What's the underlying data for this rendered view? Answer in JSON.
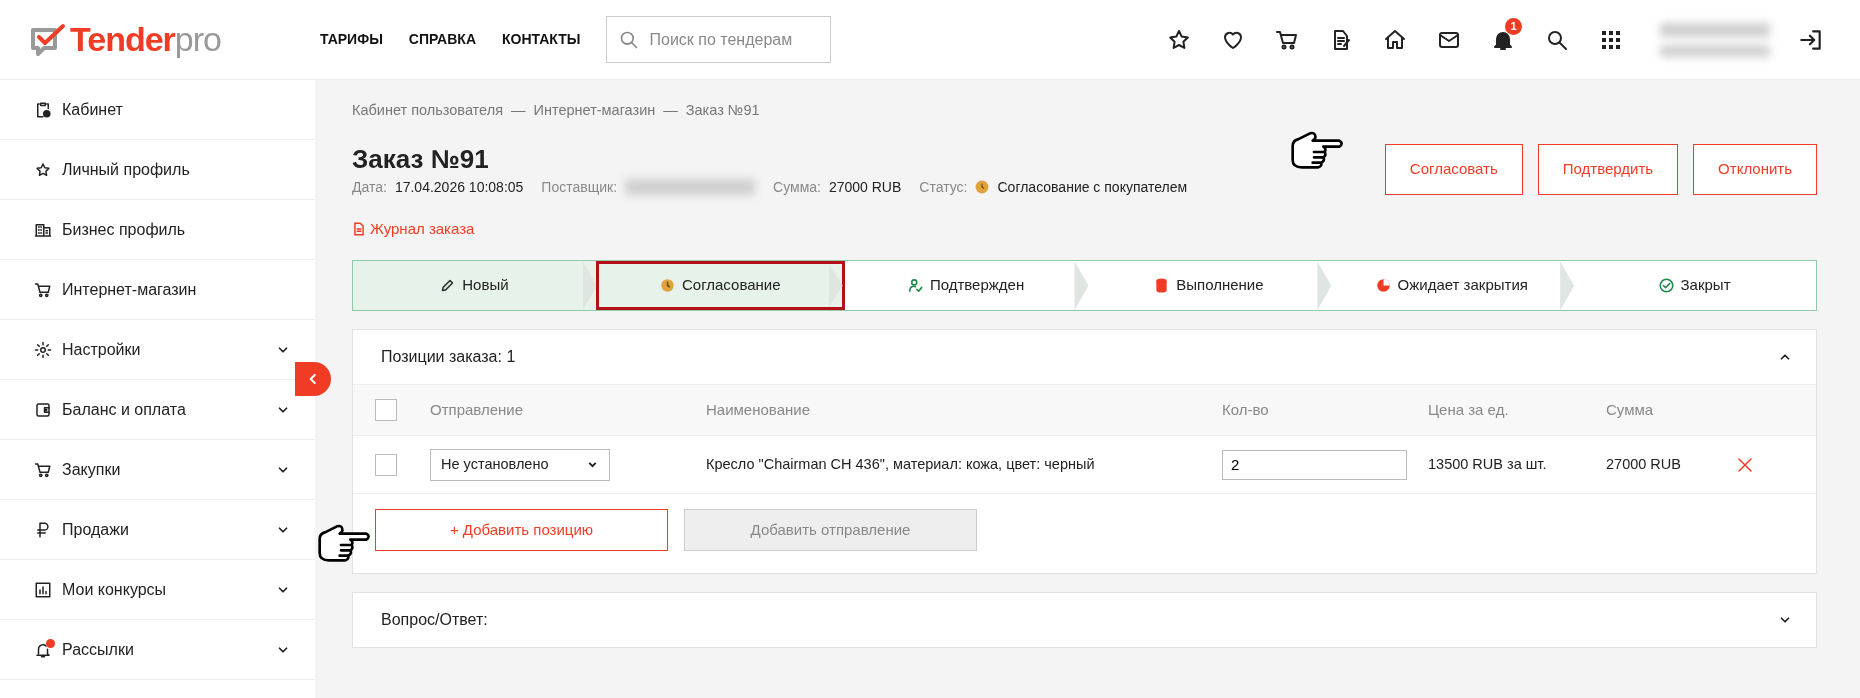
{
  "header": {
    "logo": {
      "brand": "Tender",
      "suffix": "pro"
    },
    "nav": [
      "ТАРИФЫ",
      "СПРАВКА",
      "КОНТАКТЫ"
    ],
    "search": {
      "placeholder": "Поиск по тендерам"
    },
    "notification_count": "1",
    "user": {
      "blurred": true
    }
  },
  "sidebar": {
    "items": [
      {
        "label": "Кабинет",
        "expandable": false,
        "alert": false
      },
      {
        "label": "Личный профиль",
        "expandable": false,
        "alert": false
      },
      {
        "label": "Бизнес профиль",
        "expandable": false,
        "alert": false
      },
      {
        "label": "Интернет-магазин",
        "expandable": false,
        "alert": false
      },
      {
        "label": "Настройки",
        "expandable": true,
        "alert": false
      },
      {
        "label": "Баланс и оплата",
        "expandable": true,
        "alert": false
      },
      {
        "label": "Закупки",
        "expandable": true,
        "alert": false
      },
      {
        "label": "Продажи",
        "expandable": true,
        "alert": false
      },
      {
        "label": "Мои конкурсы",
        "expandable": true,
        "alert": false
      },
      {
        "label": "Рассылки",
        "expandable": true,
        "alert": true
      }
    ]
  },
  "breadcrumb": {
    "separator": "—",
    "items": [
      "Кабинет пользователя",
      "Интернет-магазин",
      "Заказ №91"
    ]
  },
  "order": {
    "title": "Заказ №91",
    "fields": [
      {
        "label": "Дата:",
        "value": "17.04.2026 10:08:05"
      },
      {
        "label": "Поставщик:",
        "blurred": true
      },
      {
        "label": "Сумма:",
        "value": "27000 RUB"
      },
      {
        "label": "Статус:",
        "value": "Согласование с покупателем",
        "color": "#e2a23b"
      }
    ],
    "journal_link": "Журнал заказа",
    "actions": [
      "Согласовать",
      "Подтвердить",
      "Отклонить"
    ]
  },
  "steps": [
    {
      "label": "Новый",
      "reached": true,
      "highlighted": false
    },
    {
      "label": "Согласование",
      "reached": true,
      "highlighted": true
    },
    {
      "label": "Подтвержден",
      "reached": false,
      "highlighted": false
    },
    {
      "label": "Выполнение",
      "reached": false,
      "highlighted": false
    },
    {
      "label": "Ожидает закрытия",
      "reached": false,
      "highlighted": false
    },
    {
      "label": "Закрыт",
      "reached": false,
      "highlighted": false
    }
  ],
  "positions": {
    "title": "Позиции заказа: 1",
    "expanded": true,
    "select_all_checked": false,
    "columns": [
      "Отправление",
      "Наименование",
      "Кол-во",
      "Цена за ед.",
      "Сумма"
    ],
    "rows": [
      {
        "checked": false,
        "shipping": "Не установлено",
        "name": "Кресло \"Chairman CH 436\", материал: кожа, цвет: черный",
        "quantity": "2",
        "price": "13500 RUB за шт.",
        "sum": "27000 RUB"
      }
    ],
    "buttons": [
      {
        "label": "+ Добавить позицию",
        "disabled": false
      },
      {
        "label": "Добавить отправление",
        "disabled": true
      }
    ]
  },
  "qa": {
    "title": "Вопрос/Ответ:",
    "expanded": false
  }
}
